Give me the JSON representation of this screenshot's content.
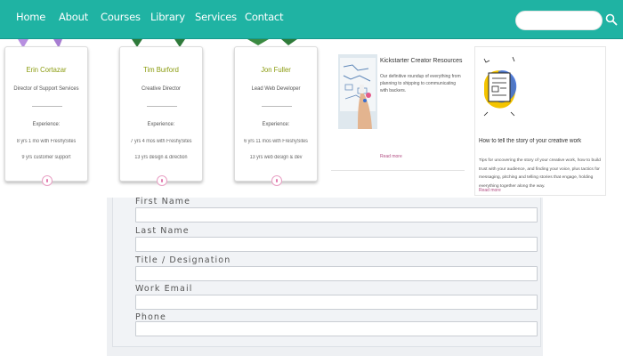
{
  "nav": {
    "items": [
      "Home",
      "About",
      "Courses",
      "Library",
      "Services",
      "Contact"
    ],
    "search_placeholder": "",
    "search_icon": "search-icon",
    "bg_color": "#1fb3a3"
  },
  "staff": [
    {
      "name": "Erin Cortazar",
      "role": "Director of Support Services",
      "experience_heading": "Experience:",
      "experience_1": "8 yrs 1 mo with FreshySites",
      "experience_2": "9 yrs customer support"
    },
    {
      "name": "Tim Burford",
      "role": "Creative Director",
      "experience_heading": "Experience:",
      "experience_1": "7 yrs 4 mos with FreshySites",
      "experience_2": "13 yrs design & direction"
    },
    {
      "name": "Jon Fuller",
      "role": "Lead Web Developer",
      "experience_heading": "Experience:",
      "experience_1": "6 yrs 11 mos with FreshySites",
      "experience_2": "13 yrs web design & dev"
    }
  ],
  "resources": [
    {
      "title": "Kickstarter Creator Resources",
      "description": "Our definitive roundup of everything from planning to shipping to communicating with backers.",
      "read_more": "Read more"
    },
    {
      "title": "How to tell the story of your creative work",
      "description": "Tips for uncovering the story of your creative work, how to build trust with your audience, and finding your voice, plus tactics for messaging, pitching and telling stories that engage, holding everything together along the way.",
      "read_more": "Read more"
    }
  ],
  "form": {
    "fields": [
      {
        "label": "First Name",
        "value": ""
      },
      {
        "label": "Last Name",
        "value": ""
      },
      {
        "label": "Title / Designation",
        "value": ""
      },
      {
        "label": "Work Email",
        "value": ""
      },
      {
        "label": "Phone",
        "value": ""
      }
    ]
  }
}
